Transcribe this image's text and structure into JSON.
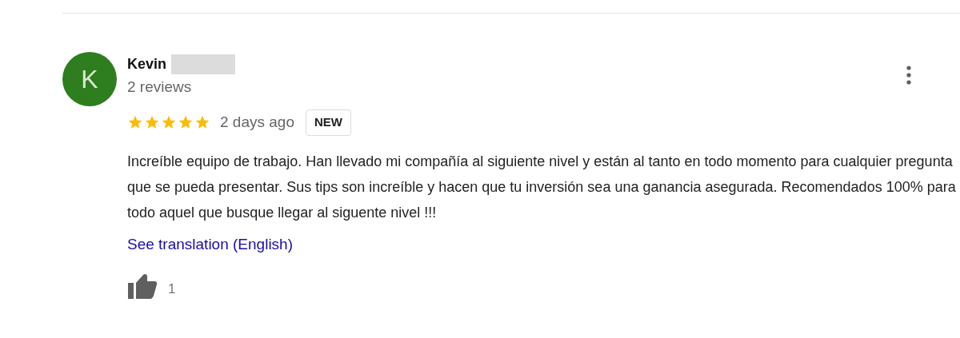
{
  "review": {
    "avatar_letter": "K",
    "author": "Kevin",
    "reviews_count": "2 reviews",
    "stars": 5,
    "time": "2 days ago",
    "badge": "NEW",
    "text": "Increíble equipo de trabajo. Han llevado mi compañía al siguiente nivel y están al tanto en todo momento para cualquier pregunta que se pueda presentar. Sus tips son increíble y hacen que tu inversión sea una ganancia asegurada. Recomendados 100% para todo aquel que busque llegar al siguente nivel !!!",
    "translation_link": "See translation (English)",
    "likes": "1"
  }
}
